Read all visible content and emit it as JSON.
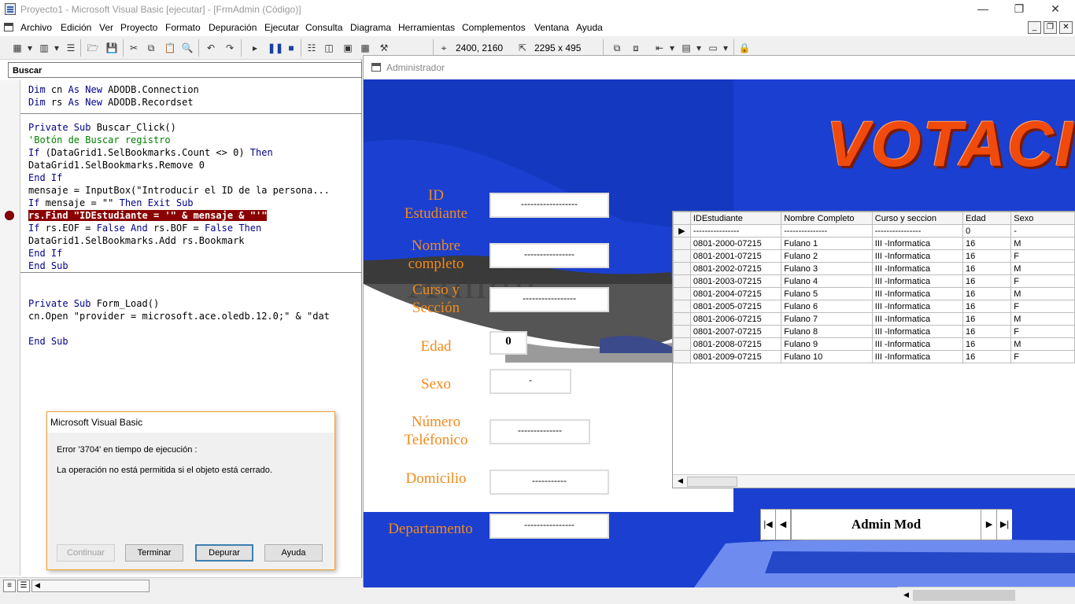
{
  "window": {
    "title": "Proyecto1 - Microsoft Visual Basic [ejecutar] - [FrmAdmin (Código)]"
  },
  "menu": [
    "Archivo",
    "Edición",
    "Ver",
    "Proyecto",
    "Formato",
    "Depuración",
    "Ejecutar",
    "Consulta",
    "Diagrama",
    "Herramientas",
    "Complementos",
    "Ventana",
    "Ayuda"
  ],
  "toolbar": {
    "position": "2400, 2160",
    "size": "2295 x 495"
  },
  "code": {
    "object_combo": "Buscar",
    "block1": [
      "Dim cn As New ADODB.Connection",
      "Dim rs As New ADODB.Recordset"
    ],
    "block2": [
      "Private Sub Buscar_Click()",
      "'Botón de Buscar registro",
      "If (DataGrid1.SelBookmarks.Count <> 0) Then",
      "DataGrid1.SelBookmarks.Remove 0",
      "End If",
      "mensaje = InputBox(\"Introducir el ID de la persona...",
      "If mensaje = \"\" Then Exit Sub",
      "rs.Find \"IDEstudiante = '\" & mensaje & \"'\"",
      "If rs.EOF = False And rs.BOF = False Then",
      "DataGrid1.SelBookmarks.Add rs.Bookmark",
      "End If",
      "End Sub"
    ],
    "block3": [
      "Private Sub Form_Load()",
      "cn.Open \"provider = microsoft.ace.oledb.12.0;\" & \"dat",
      "",
      "End Sub"
    ]
  },
  "form": {
    "title": "Administrador",
    "banner": "VOTACIO",
    "watermark": "Admin",
    "labels": {
      "id": "ID\nEstudiante",
      "nombre": "Nombre\ncompleto",
      "curso": "Curso y\nSección",
      "edad": "Edad",
      "sexo": "Sexo",
      "telefono": "Número\nTeléfonico",
      "domicilio": "Domicilio",
      "departamento": "Departamento"
    },
    "fields": {
      "id": "------------------",
      "nombre": "----------------",
      "curso": "-----------------",
      "edad": "0",
      "sexo": "-",
      "telefono": "--------------",
      "domicilio": "-----------",
      "departamento": "----------------"
    },
    "grid": {
      "columns": [
        "IDEstudiante",
        "Nombre Completo",
        "Curso y seccion",
        "Edad",
        "Sexo"
      ],
      "current_row": [
        "----------------",
        "---------------",
        "----------------",
        "0",
        "-"
      ],
      "rows": [
        [
          "0801-2000-07215",
          "Fulano 1",
          "III -Informatica",
          "16",
          "M"
        ],
        [
          "0801-2001-07215",
          "Fulano 2",
          "III -Informatica",
          "16",
          "F"
        ],
        [
          "0801-2002-07215",
          "Fulano 3",
          "III -Informatica",
          "16",
          "M"
        ],
        [
          "0801-2003-07215",
          "Fulano 4",
          "III -Informatica",
          "16",
          "F"
        ],
        [
          "0801-2004-07215",
          "Fulano 5",
          "III -Informatica",
          "16",
          "M"
        ],
        [
          "0801-2005-07215",
          "Fulano 6",
          "III -Informatica",
          "16",
          "F"
        ],
        [
          "0801-2006-07215",
          "Fulano 7",
          "III -Informatica",
          "16",
          "M"
        ],
        [
          "0801-2007-07215",
          "Fulano 8",
          "III -Informatica",
          "16",
          "F"
        ],
        [
          "0801-2008-07215",
          "Fulano 9",
          "III -Informatica",
          "16",
          "M"
        ],
        [
          "0801-2009-07215",
          "Fulano 10",
          "III -Informatica",
          "16",
          "F"
        ]
      ]
    },
    "ado_caption": "Admin Mod"
  },
  "dialog": {
    "title": "Microsoft Visual Basic",
    "line1": "Error '3704' en tiempo de ejecución :",
    "line2": "La operación no está permitida si el objeto está cerrado.",
    "buttons": {
      "continue": "Continuar",
      "end": "Terminar",
      "debug": "Depurar",
      "help": "Ayuda"
    }
  },
  "colors": {
    "form_bg": "#1b3fd0",
    "label": "#f28a1a",
    "breakpoint": "#8b0000",
    "keyword": "#00008b",
    "comment": "#008000"
  }
}
